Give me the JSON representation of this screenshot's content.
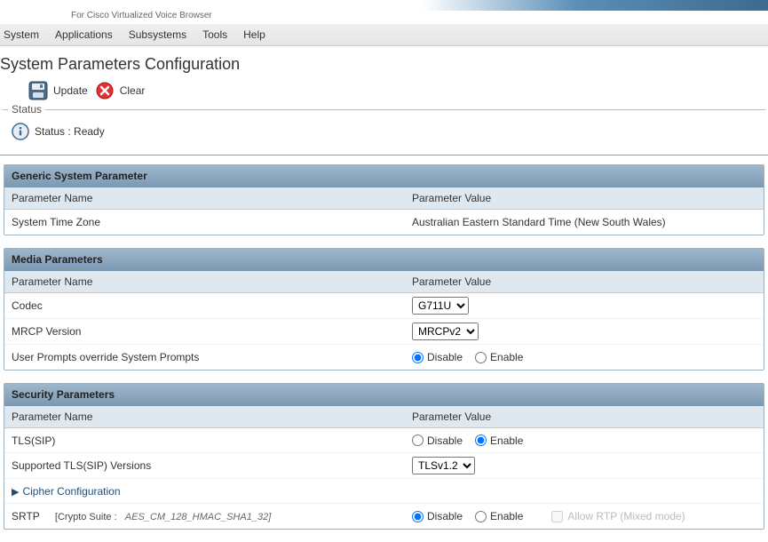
{
  "subtitle": "For Cisco Virtualized Voice Browser",
  "menubar": [
    "System",
    "Applications",
    "Subsystems",
    "Tools",
    "Help"
  ],
  "page_title": "System Parameters Configuration",
  "toolbar": {
    "update": "Update",
    "clear": "Clear"
  },
  "status": {
    "legend": "Status",
    "text": "Status : Ready"
  },
  "sections": {
    "generic": {
      "title": "Generic System Parameter",
      "columns": {
        "name": "Parameter Name",
        "value": "Parameter Value"
      },
      "rows": {
        "timezone": {
          "name": "System Time Zone",
          "value": "Australian Eastern Standard Time (New South Wales)"
        }
      }
    },
    "media": {
      "title": "Media Parameters",
      "columns": {
        "name": "Parameter Name",
        "value": "Parameter Value"
      },
      "rows": {
        "codec": {
          "name": "Codec",
          "options": [
            "G711U"
          ],
          "selected": "G711U"
        },
        "mrcp": {
          "name": "MRCP Version",
          "options": [
            "MRCPv2"
          ],
          "selected": "MRCPv2"
        },
        "override": {
          "name": "User Prompts override System Prompts",
          "disable": "Disable",
          "enable": "Enable",
          "selected": "disable"
        }
      }
    },
    "security": {
      "title": "Security Parameters",
      "columns": {
        "name": "Parameter Name",
        "value": "Parameter Value"
      },
      "rows": {
        "tls": {
          "name": "TLS(SIP)",
          "disable": "Disable",
          "enable": "Enable",
          "selected": "enable"
        },
        "tlsver": {
          "name": "Supported TLS(SIP) Versions",
          "options": [
            "TLSv1.2"
          ],
          "selected": "TLSv1.2"
        },
        "cipher": {
          "name": "Cipher Configuration"
        },
        "srtp": {
          "name": "SRTP",
          "crypto_label": "[Crypto Suite :",
          "crypto_value": "AES_CM_128_HMAC_SHA1_32]",
          "disable": "Disable",
          "enable": "Enable",
          "selected": "disable",
          "allow_rtp": "Allow RTP (Mixed mode)"
        }
      }
    }
  }
}
